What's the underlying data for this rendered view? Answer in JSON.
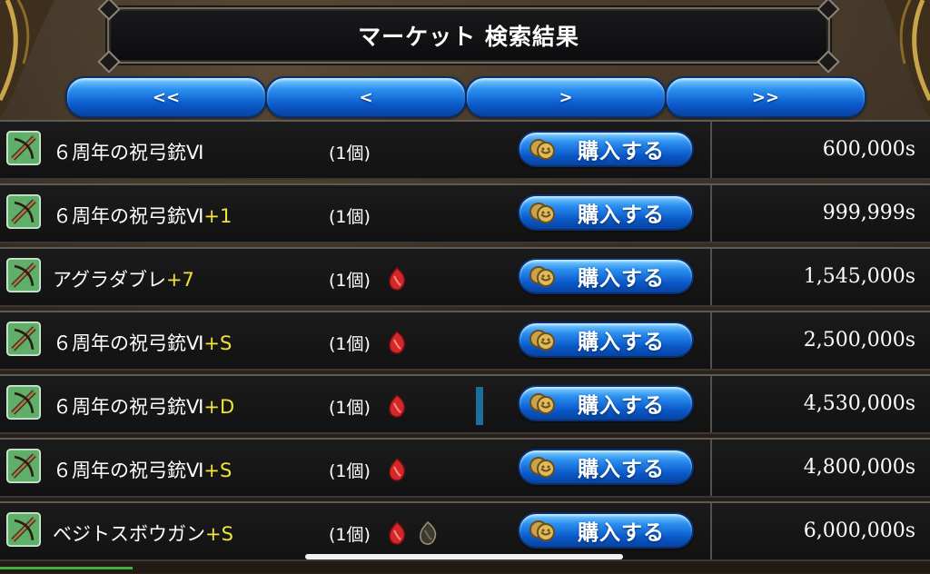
{
  "title": "マーケット 検索結果",
  "nav": {
    "first": "<<",
    "prev": "<",
    "next": ">",
    "last": ">>"
  },
  "buy_label": "購入する",
  "items": [
    {
      "name": "６周年の祝弓銃Ⅵ",
      "plus": "",
      "qty": "(1個)",
      "gems": [],
      "price": "600,000s"
    },
    {
      "name": "６周年の祝弓銃Ⅵ",
      "plus": "+1",
      "qty": "(1個)",
      "gems": [],
      "price": "999,999s"
    },
    {
      "name": "アグラダブレ",
      "plus": "+7",
      "qty": "(1個)",
      "gems": [
        "red"
      ],
      "price": "1,545,000s"
    },
    {
      "name": "６周年の祝弓銃Ⅵ",
      "plus": "+S",
      "qty": "(1個)",
      "gems": [
        "red"
      ],
      "price": "2,500,000s"
    },
    {
      "name": "６周年の祝弓銃Ⅵ",
      "plus": "+D",
      "qty": "(1個)",
      "gems": [
        "red"
      ],
      "price": "4,530,000s"
    },
    {
      "name": "６周年の祝弓銃Ⅵ",
      "plus": "+S",
      "qty": "(1個)",
      "gems": [
        "red"
      ],
      "price": "4,800,000s"
    },
    {
      "name": "ベジトスボウガン",
      "plus": "+S",
      "qty": "(1個)",
      "gems": [
        "red",
        "dark"
      ],
      "price": "6,000,000s"
    }
  ],
  "colors": {
    "button_blue": "#0a59c9",
    "plus_yellow": "#f2e23b",
    "gem_red": "#d3282a"
  }
}
